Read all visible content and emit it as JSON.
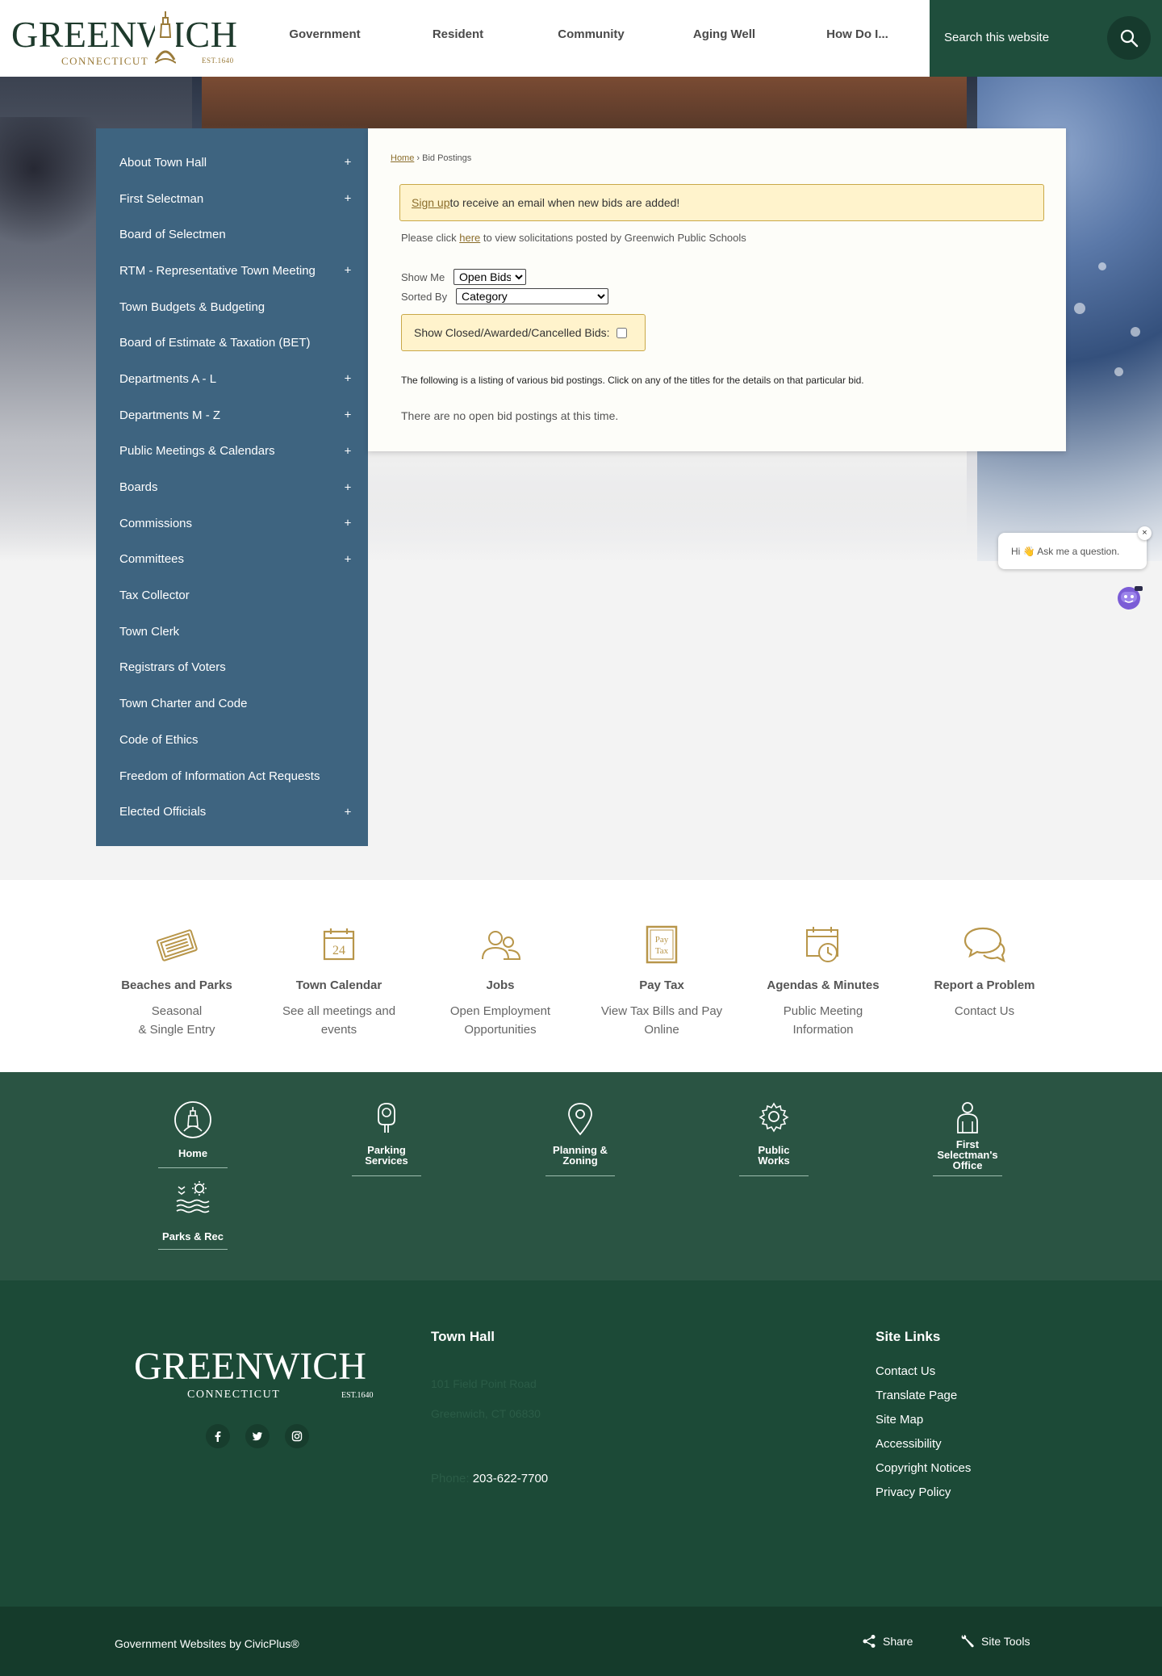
{
  "header": {
    "logo": {
      "word": "GREENWICH",
      "sub": "CONNECTICUT",
      "est": "EST.1640"
    },
    "nav": [
      "Government",
      "Resident",
      "Community",
      "Aging Well",
      "How Do I..."
    ],
    "search_placeholder": "Search this website"
  },
  "sidebar": {
    "items": [
      {
        "label": "About Town Hall",
        "expandable": "+"
      },
      {
        "label": "First Selectman",
        "expandable": "+"
      },
      {
        "label": "Board of Selectmen",
        "expandable": ""
      },
      {
        "label": "RTM - Representative Town Meeting",
        "expandable": "+"
      },
      {
        "label": "Town Budgets & Budgeting",
        "expandable": ""
      },
      {
        "label": "Board of Estimate & Taxation (BET)",
        "expandable": ""
      },
      {
        "label": "Departments A - L",
        "expandable": "+"
      },
      {
        "label": "Departments M - Z",
        "expandable": "+"
      },
      {
        "label": "Public Meetings & Calendars",
        "expandable": "+"
      },
      {
        "label": "Boards",
        "expandable": "+"
      },
      {
        "label": "Commissions",
        "expandable": "+"
      },
      {
        "label": "Committees",
        "expandable": "+"
      },
      {
        "label": "Tax Collector",
        "expandable": ""
      },
      {
        "label": "Town Clerk",
        "expandable": ""
      },
      {
        "label": "Registrars of Voters",
        "expandable": ""
      },
      {
        "label": "Town Charter and Code",
        "expandable": ""
      },
      {
        "label": "Code of Ethics",
        "expandable": ""
      },
      {
        "label": "Freedom of Information Act Requests",
        "expandable": ""
      },
      {
        "label": "Elected Officials",
        "expandable": "+"
      }
    ]
  },
  "content": {
    "breadcrumb": {
      "home": "Home",
      "sep": " › ",
      "current": "Bid Postings"
    },
    "notice": {
      "link": "Sign up",
      "text": " to receive an email when new bids are added!"
    },
    "schools": {
      "pre": "Please click ",
      "link": "here",
      "post": " to view solicitations posted by Greenwich Public Schools"
    },
    "show_me": {
      "label": "Show Me",
      "value": "Open Bids"
    },
    "sorted_by": {
      "label": "Sorted By",
      "value": "Category"
    },
    "closed_label": "Show Closed/Awarded/Cancelled Bids:",
    "listing_text": "The following is a listing of various bid postings. Click on any of the titles for the details on that particular bid.",
    "empty_text": "There are no open bid postings at this time."
  },
  "chat": {
    "greeting": "Hi 👋 Ask me a question.",
    "close": "×"
  },
  "quick_links": [
    {
      "title": "Beaches and Parks",
      "line1": "Seasonal",
      "line2": "& Single Entry"
    },
    {
      "title": "Town Calendar",
      "line1": "See all meetings and",
      "line2": "events",
      "icon_text": "24"
    },
    {
      "title": "Jobs",
      "line1": "Open Employment",
      "line2": "Opportunities"
    },
    {
      "title": "Pay Tax",
      "line1": "View Tax Bills and Pay",
      "line2": "Online",
      "icon_text1": "Pay",
      "icon_text2": "Tax"
    },
    {
      "title": "Agendas & Minutes",
      "line1": "Public Meeting",
      "line2": "Information"
    },
    {
      "title": "Report a Problem",
      "line1": "Contact Us",
      "line2": ""
    }
  ],
  "green_nav": [
    {
      "line1": "Home",
      "line2": "",
      "line3": ""
    },
    {
      "line1": "Parking",
      "line2": "Services",
      "line3": ""
    },
    {
      "line1": "Planning &",
      "line2": "Zoning",
      "line3": ""
    },
    {
      "line1": "Public",
      "line2": "Works",
      "line3": ""
    },
    {
      "line1": "First",
      "line2": "Selectman's",
      "line3": "Office"
    },
    {
      "line1": "Parks & Rec",
      "line2": "",
      "line3": ""
    }
  ],
  "footer": {
    "logo": {
      "word": "GREENWICH",
      "sub": "CONNECTICUT",
      "est": "EST.1640"
    },
    "town_hall_heading": "Town Hall",
    "address1": "101 Field Point Road",
    "address2": "Greenwich, CT 06830",
    "phone_label": "Phone: ",
    "phone": "203-622-7700",
    "site_links_heading": "Site Links",
    "site_links": [
      "Contact Us",
      "Translate Page",
      "Site Map",
      "Accessibility",
      "Copyright Notices",
      "Privacy Policy"
    ]
  },
  "bottom_bar": {
    "civic": "Government Websites by CivicPlus®",
    "share": "Share",
    "site_tools": "Site Tools"
  },
  "colors": {
    "brand_green": "#1f4e3c",
    "sidebar_blue": "#3e6480",
    "gold": "#b8964a",
    "notice_bg": "#fff3cc"
  }
}
